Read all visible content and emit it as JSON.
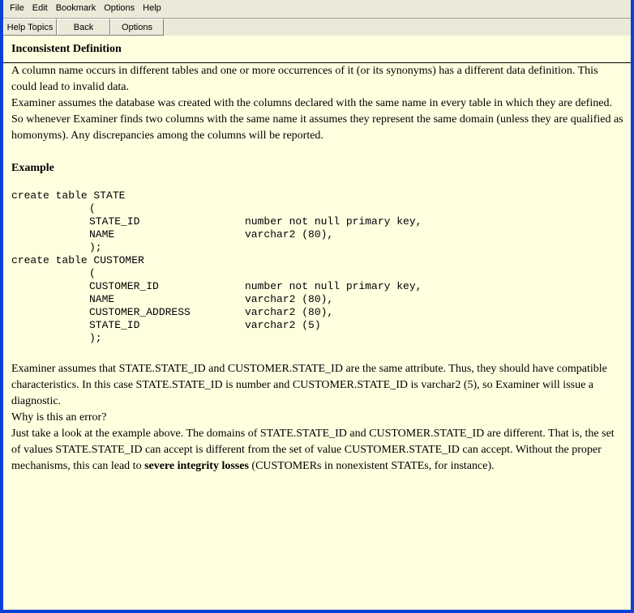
{
  "menu": [
    "File",
    "Edit",
    "Bookmark",
    "Options",
    "Help"
  ],
  "toolbar": {
    "help_topics": "Help Topics",
    "back": "Back",
    "options": "Options"
  },
  "title": "Inconsistent Definition",
  "intro": [
    "A column name occurs in different tables and one or more occurrences of it (or its synonyms) has a different data definition. This could lead to invalid data.",
    "Examiner assumes the database was created with the columns declared with the same name in every table in which they are defined. So whenever Examiner finds two columns with the same name it assumes they represent the same domain (unless they are qualified as homonyms). Any discrepancies among the columns will be reported."
  ],
  "example_heading": "Example",
  "code": [
    {
      "a": "create table STATE",
      "b": "",
      "c": ""
    },
    {
      "a": "",
      "b": "(",
      "c": ""
    },
    {
      "a": "",
      "b": "STATE_ID",
      "c": "number not null primary key,"
    },
    {
      "a": "",
      "b": "NAME",
      "c": "varchar2 (80),"
    },
    {
      "a": "",
      "b": ");",
      "c": ""
    },
    {
      "a": "create table CUSTOMER",
      "b": "",
      "c": ""
    },
    {
      "a": "",
      "b": "(",
      "c": ""
    },
    {
      "a": "",
      "b": "CUSTOMER_ID",
      "c": "number not null primary key,"
    },
    {
      "a": "",
      "b": "NAME",
      "c": "varchar2 (80),"
    },
    {
      "a": "",
      "b": "CUSTOMER_ADDRESS",
      "c": "varchar2 (80),"
    },
    {
      "a": "",
      "b": "STATE_ID",
      "c": "varchar2 (5)"
    },
    {
      "a": "",
      "b": ");",
      "c": ""
    }
  ],
  "explain": {
    "p1": "Examiner assumes that STATE.STATE_ID and CUSTOMER.STATE_ID are the same attribute. Thus, they should have compatible characteristics. In this case STATE.STATE_ID is number and CUSTOMER.STATE_ID is varchar2 (5), so Examiner will issue a diagnostic.",
    "p2": "Why is this an error?",
    "p3a": "Just take a look at the example above. The domains of STATE.STATE_ID and CUSTOMER.STATE_ID are different. That is, the set of values STATE.STATE_ID can accept is different from the set of value CUSTOMER.STATE_ID can accept. Without the proper mechanisms, this can lead to ",
    "p3b": "severe integrity losses",
    "p3c": " (CUSTOMERs in nonexistent STATEs, for instance)."
  }
}
